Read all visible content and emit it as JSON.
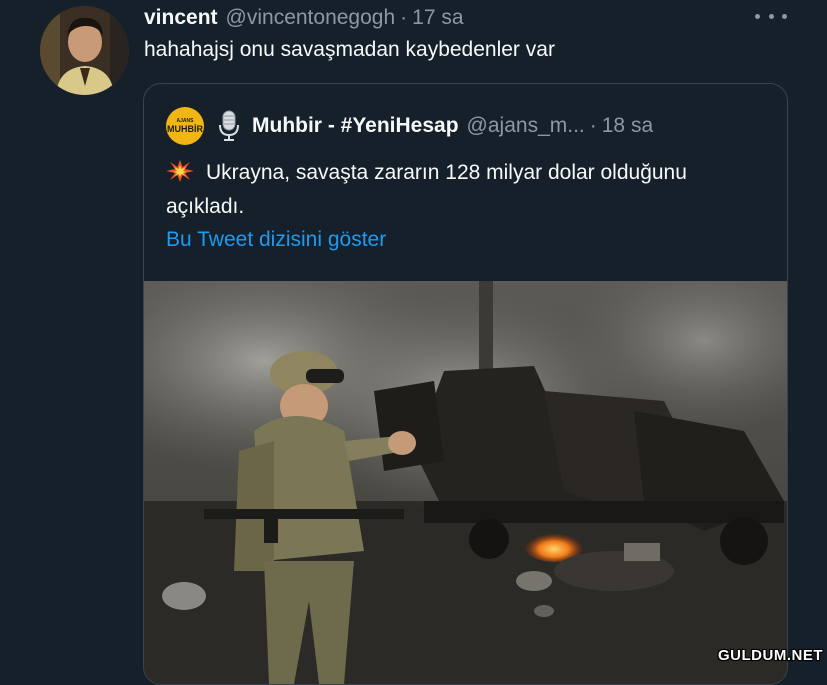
{
  "tweet": {
    "display_name": "vincent",
    "handle": "@vincentonegogh",
    "separator": "·",
    "time": "17 sa",
    "text": "hahahajsj onu savaşmadan kaybedenler var",
    "avatar_icon": "profile-photo",
    "more_icon": "more-horizontal-icon"
  },
  "quote": {
    "logo_line1": "AJANS",
    "logo_line2": "MUHBİR",
    "badge_icon": "microphone-icon",
    "display_name": "Muhbir - #YeniHesap",
    "handle": "@ajans_m...",
    "separator": "·",
    "time": "18 sa",
    "text_icon": "collision-icon",
    "text": "Ukrayna, savaşta zararın 128 milyar dolar olduğunu açıkladı.",
    "thread_link": "Bu Tweet dizisini göster"
  },
  "watermark": "GULDUM.NET",
  "colors": {
    "background": "#15202b",
    "border": "#38444d",
    "secondary_text": "#8b98a5",
    "link": "#1d9bf0",
    "logo_yellow": "#f2b614"
  }
}
